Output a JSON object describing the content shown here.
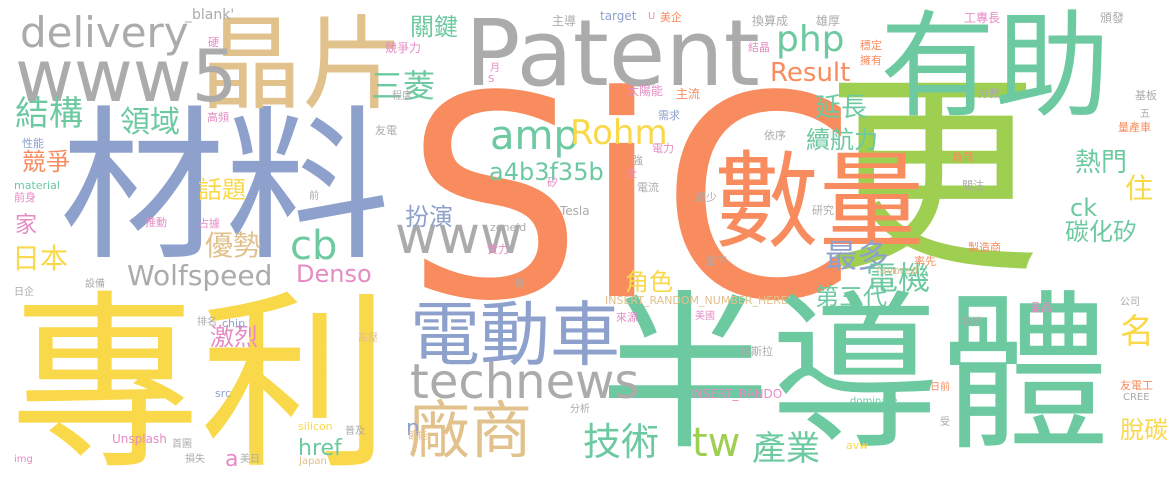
{
  "palette": {
    "yellow": "#f9d84a",
    "green": "#6cc9a0",
    "lime": "#9fcf50",
    "orange": "#f88c5e",
    "blue": "#8ea1cc",
    "tan": "#e1c18c",
    "gray": "#ababab",
    "pink": "#e58cc4"
  },
  "words": [
    {
      "text": "SiC",
      "color": "orange"
    },
    {
      "text": "專利",
      "color": "yellow"
    },
    {
      "text": "半導體",
      "color": "green"
    },
    {
      "text": "更",
      "color": "lime"
    },
    {
      "text": "材料",
      "color": "blue"
    },
    {
      "text": "有助",
      "color": "green"
    },
    {
      "text": "數量",
      "color": "orange"
    },
    {
      "text": "Patent",
      "color": "gray"
    },
    {
      "text": "晶片",
      "color": "tan"
    },
    {
      "text": "www5",
      "color": "gray"
    },
    {
      "text": "delivery",
      "color": "gray"
    },
    {
      "text": "電動車",
      "color": "blue"
    },
    {
      "text": "廠商",
      "color": "tan"
    },
    {
      "text": "technews",
      "color": "gray"
    },
    {
      "text": "www",
      "color": "gray"
    },
    {
      "text": "amp",
      "color": "green"
    },
    {
      "text": "cb",
      "color": "green"
    },
    {
      "text": "php",
      "color": "green"
    },
    {
      "text": "tw",
      "color": "lime"
    },
    {
      "text": "技術",
      "color": "green"
    },
    {
      "text": "Wolfspeed",
      "color": "gray"
    },
    {
      "text": "Rohm",
      "color": "yellow"
    },
    {
      "text": "a4b3f35b",
      "color": "green"
    },
    {
      "text": "Result",
      "color": "orange"
    },
    {
      "text": "Denso",
      "color": "pink"
    },
    {
      "text": "結構",
      "color": "green"
    },
    {
      "text": "三菱",
      "color": "green"
    },
    {
      "text": "關鍵",
      "color": "green"
    },
    {
      "text": "領域",
      "color": "green"
    },
    {
      "text": "優勢",
      "color": "tan"
    },
    {
      "text": "日本",
      "color": "yellow"
    },
    {
      "text": "話題",
      "color": "yellow"
    },
    {
      "text": "競爭",
      "color": "orange"
    },
    {
      "text": "扮演",
      "color": "blue"
    },
    {
      "text": "延長",
      "color": "green"
    },
    {
      "text": "續航力",
      "color": "green"
    },
    {
      "text": "最多",
      "color": "blue"
    },
    {
      "text": "電機",
      "color": "green"
    },
    {
      "text": "碳化矽",
      "color": "green"
    },
    {
      "text": "熱門",
      "color": "green"
    },
    {
      "text": "住",
      "color": "yellow"
    },
    {
      "text": "名",
      "color": "yellow"
    },
    {
      "text": "角色",
      "color": "yellow"
    },
    {
      "text": "第三代",
      "color": "green"
    },
    {
      "text": "產業",
      "color": "green"
    },
    {
      "text": "脫碳",
      "color": "yellow"
    },
    {
      "text": "激烈",
      "color": "pink"
    },
    {
      "text": "href",
      "color": "green"
    },
    {
      "text": "ck",
      "color": "green"
    },
    {
      "text": "n",
      "color": "blue"
    },
    {
      "text": "a",
      "color": "pink"
    },
    {
      "text": "家",
      "color": "pink"
    },
    {
      "text": "_blank'",
      "color": "gray"
    },
    {
      "text": "target",
      "color": "blue"
    },
    {
      "text": "U",
      "color": "pink"
    },
    {
      "text": "美企",
      "color": "orange"
    },
    {
      "text": "換算成",
      "color": "gray"
    },
    {
      "text": "雄厚",
      "color": "gray"
    },
    {
      "text": "工專長",
      "color": "pink"
    },
    {
      "text": "頒發",
      "color": "gray"
    },
    {
      "text": "主導",
      "color": "gray"
    },
    {
      "text": "競爭力",
      "color": "pink"
    },
    {
      "text": "硬",
      "color": "pink"
    },
    {
      "text": "結晶",
      "color": "pink"
    },
    {
      "text": "穩定",
      "color": "orange"
    },
    {
      "text": "擁有",
      "color": "orange"
    },
    {
      "text": "月",
      "color": "pink"
    },
    {
      "text": "S",
      "color": "pink"
    },
    {
      "text": "太陽能",
      "color": "pink"
    },
    {
      "text": "主流",
      "color": "orange"
    },
    {
      "text": "分數",
      "color": "gray"
    },
    {
      "text": "基板",
      "color": "gray"
    },
    {
      "text": "程度",
      "color": "gray"
    },
    {
      "text": "高頻",
      "color": "pink"
    },
    {
      "text": "需求",
      "color": "blue"
    },
    {
      "text": "五",
      "color": "gray"
    },
    {
      "text": "量產車",
      "color": "orange"
    },
    {
      "text": "性能",
      "color": "blue"
    },
    {
      "text": "友電",
      "color": "gray"
    },
    {
      "text": "material",
      "color": "green"
    },
    {
      "text": "電力",
      "color": "pink"
    },
    {
      "text": "依序",
      "color": "gray"
    },
    {
      "text": "強",
      "color": "gray"
    },
    {
      "text": "負荷",
      "color": "orange"
    },
    {
      "text": "全",
      "color": "pink"
    },
    {
      "text": "矽",
      "color": "pink"
    },
    {
      "text": "電流",
      "color": "gray"
    },
    {
      "text": "關注",
      "color": "gray"
    },
    {
      "text": "前身",
      "color": "pink"
    },
    {
      "text": "前",
      "color": "gray"
    },
    {
      "text": "減少",
      "color": "gray"
    },
    {
      "text": "Tesla",
      "color": "gray"
    },
    {
      "text": "推動",
      "color": "pink"
    },
    {
      "text": "占據",
      "color": "pink"
    },
    {
      "text": "zoneid",
      "color": "gray"
    },
    {
      "text": "研究",
      "color": "gray"
    },
    {
      "text": "製造商",
      "color": "orange"
    },
    {
      "text": "實力",
      "color": "pink"
    },
    {
      "text": "拿下",
      "color": "gray"
    },
    {
      "text": "率先",
      "color": "orange"
    },
    {
      "text": "favored",
      "color": "tan"
    },
    {
      "text": "日企",
      "color": "gray"
    },
    {
      "text": "設備",
      "color": "gray"
    },
    {
      "text": "項",
      "color": "gray"
    },
    {
      "text": "INSERT_RANDOM_NUMBER_HERE'",
      "color": "tan"
    },
    {
      "text": "公司",
      "color": "gray"
    },
    {
      "text": "排名",
      "color": "gray"
    },
    {
      "text": "chip",
      "color": "blue"
    },
    {
      "text": "來源",
      "color": "pink"
    },
    {
      "text": "美國",
      "color": "pink"
    },
    {
      "text": "晶晶",
      "color": "pink"
    },
    {
      "text": "科說",
      "color": "gray"
    },
    {
      "text": "高壓",
      "color": "tan"
    },
    {
      "text": "特斯拉",
      "color": "gray"
    },
    {
      "text": "友電工",
      "color": "orange"
    },
    {
      "text": "日前",
      "color": "orange"
    },
    {
      "text": "CREE",
      "color": "gray"
    },
    {
      "text": "INSERT_RANDO",
      "color": "pink"
    },
    {
      "text": "src",
      "color": "blue"
    },
    {
      "text": "dominate",
      "color": "green"
    },
    {
      "text": "分析",
      "color": "gray"
    },
    {
      "text": "受",
      "color": "gray"
    },
    {
      "text": "silicon",
      "color": "yellow"
    },
    {
      "text": "普及",
      "color": "gray"
    },
    {
      "text": "Unsplash",
      "color": "pink"
    },
    {
      "text": "節能",
      "color": "tan"
    },
    {
      "text": "首圖",
      "color": "gray"
    },
    {
      "text": "avw",
      "color": "yellow"
    },
    {
      "text": "img",
      "color": "pink"
    },
    {
      "text": "損失",
      "color": "gray"
    },
    {
      "text": "美日",
      "color": "gray"
    },
    {
      "text": "Japan",
      "color": "tan"
    }
  ]
}
